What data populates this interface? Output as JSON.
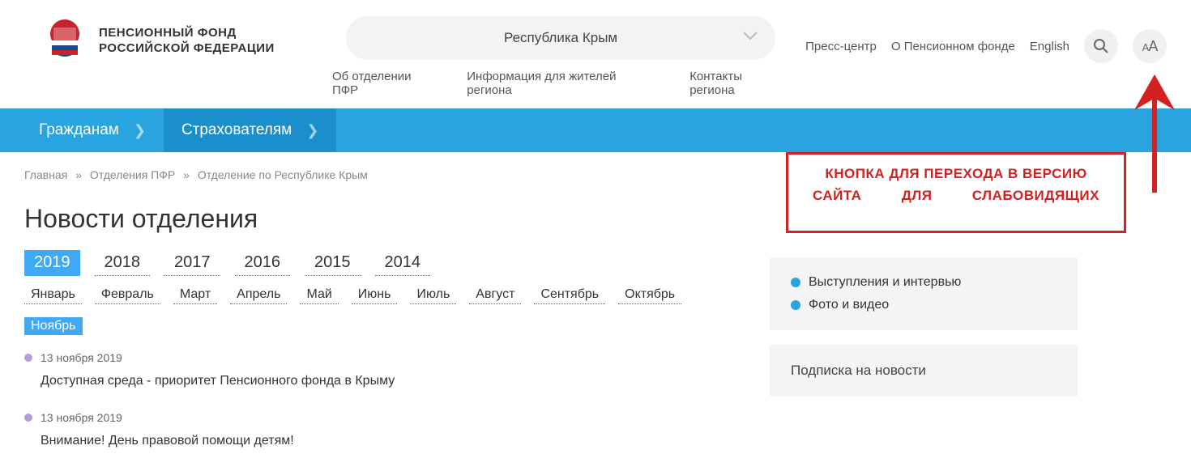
{
  "logo": {
    "line1": "ПЕНСИОННЫЙ ФОНД",
    "line2": "РОССИЙСКОЙ ФЕДЕРАЦИИ"
  },
  "region_select": {
    "label": "Республика Крым"
  },
  "subnav": [
    {
      "label": "Об отделении ПФР"
    },
    {
      "label": "Информация для жителей региона"
    },
    {
      "label": "Контакты региона"
    }
  ],
  "topright": [
    {
      "label": "Пресс-центр"
    },
    {
      "label": "О Пенсионном фонде"
    },
    {
      "label": "English"
    }
  ],
  "bluebar": [
    {
      "label": "Гражданам",
      "active": false
    },
    {
      "label": "Страхователям",
      "active": true
    }
  ],
  "breadcrumb": [
    {
      "label": "Главная"
    },
    {
      "label": "Отделения ПФР"
    },
    {
      "label": "Отделение по Республике Крым"
    }
  ],
  "page_title": "Новости отделения",
  "years": [
    {
      "label": "2019",
      "active": true
    },
    {
      "label": "2018"
    },
    {
      "label": "2017"
    },
    {
      "label": "2016"
    },
    {
      "label": "2015"
    },
    {
      "label": "2014"
    }
  ],
  "months": [
    {
      "label": "Январь"
    },
    {
      "label": "Февраль"
    },
    {
      "label": "Март"
    },
    {
      "label": "Апрель"
    },
    {
      "label": "Май"
    },
    {
      "label": "Июнь"
    },
    {
      "label": "Июль"
    },
    {
      "label": "Август"
    },
    {
      "label": "Сентябрь"
    },
    {
      "label": "Октябрь"
    },
    {
      "label": "Ноябрь",
      "active": true
    }
  ],
  "news": [
    {
      "date": "13 ноября 2019",
      "title": "Доступная среда - приоритет Пенсионного фонда в Крыму"
    },
    {
      "date": "13 ноября 2019",
      "title": "Внимание! День правовой помощи детям!"
    }
  ],
  "sidebar": {
    "links": [
      {
        "label": "Выступления и интервью"
      },
      {
        "label": "Фото и видео"
      }
    ],
    "subscribe_title": "Подписка на новости"
  },
  "annotation": {
    "line1": "КНОПКА ДЛЯ ПЕРЕХОДА В ВЕРСИЮ",
    "line2": "САЙТА ДЛЯ СЛАБОВИДЯЩИХ"
  }
}
